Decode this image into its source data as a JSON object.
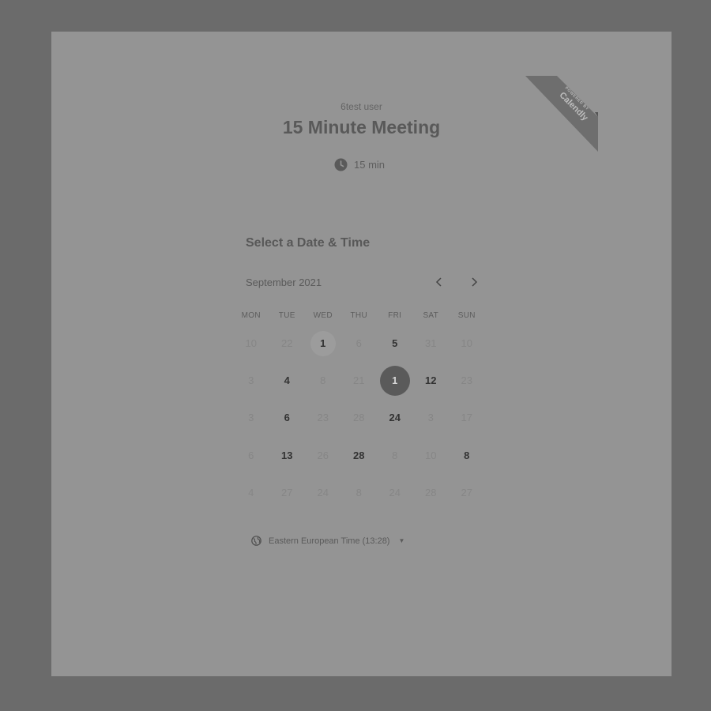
{
  "branding": {
    "ribbon_small": "powered by",
    "ribbon_big": "Calendly"
  },
  "event": {
    "host": "6test user",
    "title": "15 Minute Meeting",
    "duration": "15 min"
  },
  "calendar": {
    "section_title": "Select a Date & Time",
    "month_label": "September 2021",
    "weekdays": [
      "MON",
      "TUE",
      "WED",
      "THU",
      "FRI",
      "SAT",
      "SUN"
    ],
    "rows": [
      [
        {
          "n": "10",
          "s": "muted"
        },
        {
          "n": "22",
          "s": "muted"
        },
        {
          "n": "1",
          "s": "today"
        },
        {
          "n": "6",
          "s": "muted"
        },
        {
          "n": "5",
          "s": "avail"
        },
        {
          "n": "31",
          "s": "muted"
        },
        {
          "n": "10",
          "s": "muted"
        }
      ],
      [
        {
          "n": "3",
          "s": "muted"
        },
        {
          "n": "4",
          "s": "avail"
        },
        {
          "n": "8",
          "s": "muted"
        },
        {
          "n": "21",
          "s": "muted"
        },
        {
          "n": "1",
          "s": "selected"
        },
        {
          "n": "12",
          "s": "avail"
        },
        {
          "n": "23",
          "s": "muted"
        }
      ],
      [
        {
          "n": "3",
          "s": "muted"
        },
        {
          "n": "6",
          "s": "avail"
        },
        {
          "n": "23",
          "s": "muted"
        },
        {
          "n": "28",
          "s": "muted"
        },
        {
          "n": "24",
          "s": "avail"
        },
        {
          "n": "3",
          "s": "muted"
        },
        {
          "n": "17",
          "s": "muted"
        }
      ],
      [
        {
          "n": "6",
          "s": "muted"
        },
        {
          "n": "13",
          "s": "avail"
        },
        {
          "n": "26",
          "s": "muted"
        },
        {
          "n": "28",
          "s": "avail"
        },
        {
          "n": "8",
          "s": "muted"
        },
        {
          "n": "10",
          "s": "muted"
        },
        {
          "n": "8",
          "s": "avail"
        }
      ],
      [
        {
          "n": "4",
          "s": "muted"
        },
        {
          "n": "27",
          "s": "muted"
        },
        {
          "n": "24",
          "s": "muted"
        },
        {
          "n": "8",
          "s": "muted"
        },
        {
          "n": "24",
          "s": "muted"
        },
        {
          "n": "28",
          "s": "muted"
        },
        {
          "n": "27",
          "s": "muted"
        }
      ]
    ]
  },
  "timezone": {
    "label": "Eastern European Time (13:28)"
  },
  "colors": {
    "overlay": "#6b6b6b",
    "card": "#949494",
    "selected": "#5a5a5a",
    "ribbon": "#6e6e6e"
  },
  "icons": {
    "duration": "clock-icon",
    "prev": "chevron-left-icon",
    "next": "chevron-right-icon",
    "timezone": "globe-icon",
    "dropdown": "caret-down-icon"
  }
}
